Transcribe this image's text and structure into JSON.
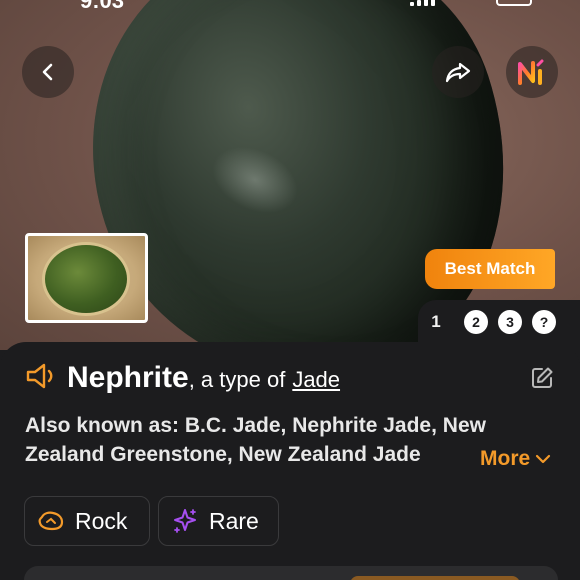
{
  "status_bar": {
    "time": "9:03"
  },
  "hero": {
    "badge": "Best Match"
  },
  "pager": {
    "pages": [
      "1",
      "2",
      "3",
      "?"
    ],
    "active_index": 0
  },
  "result": {
    "name": "Nephrite",
    "type_prefix": ", a type of",
    "type_link": "Jade",
    "aka_line1": "Also known as: B.C. Jade, Nephrite Jade, New",
    "aka_line2": "Zealand Greenstone, New Zealand Jade",
    "more_label": "More"
  },
  "tags": [
    {
      "label": "Rock",
      "icon": "rock-icon",
      "color": "#f39a2a"
    },
    {
      "label": "Rare",
      "icon": "sparkle-icon",
      "color": "#a64ff0"
    }
  ],
  "colors": {
    "accent": "#f39a2a",
    "badge": "#f0830d",
    "panel": "#1c1c1e"
  }
}
